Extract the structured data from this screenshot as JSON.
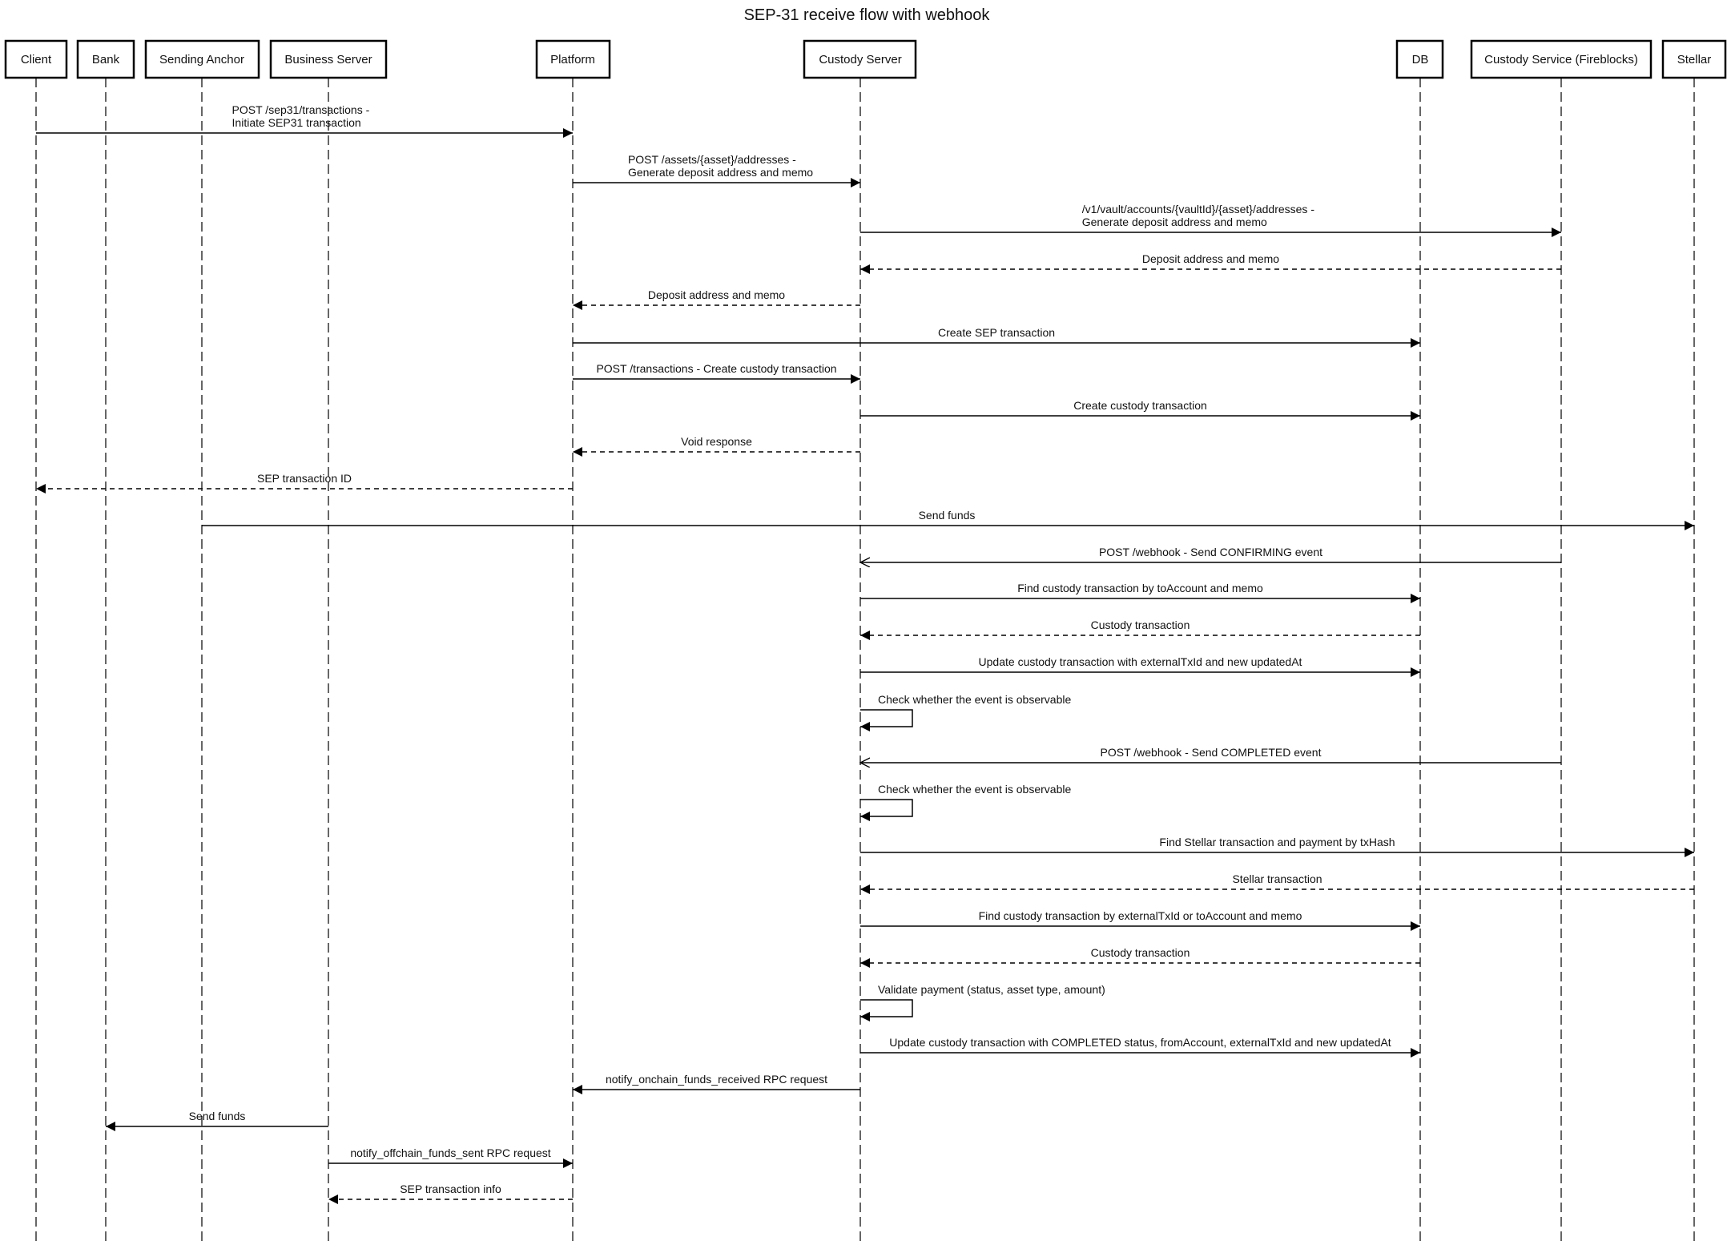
{
  "title": "SEP-31 receive flow with webhook",
  "participants": [
    {
      "id": "client",
      "label": "Client"
    },
    {
      "id": "bank",
      "label": "Bank"
    },
    {
      "id": "sending_anchor",
      "label": "Sending Anchor"
    },
    {
      "id": "business_server",
      "label": "Business Server"
    },
    {
      "id": "platform",
      "label": "Platform"
    },
    {
      "id": "custody_server",
      "label": "Custody Server"
    },
    {
      "id": "db",
      "label": "DB"
    },
    {
      "id": "custody_service",
      "label": "Custody Service (Fireblocks)"
    },
    {
      "id": "stellar",
      "label": "Stellar"
    }
  ],
  "messages": [
    {
      "from": "client",
      "to": "platform",
      "style": "sync",
      "lines": [
        "POST /sep31/transactions -",
        "Initiate SEP31  transaction"
      ]
    },
    {
      "from": "platform",
      "to": "custody_server",
      "style": "sync",
      "lines": [
        "POST /assets/{asset}/addresses -",
        "Generate deposit address and memo"
      ]
    },
    {
      "from": "custody_server",
      "to": "custody_service",
      "style": "sync",
      "lines": [
        "/v1/vault/accounts/{vaultId}/{asset}/addresses -",
        "Generate deposit address and memo"
      ]
    },
    {
      "from": "custody_service",
      "to": "custody_server",
      "style": "reply",
      "lines": [
        "Deposit address and memo"
      ]
    },
    {
      "from": "custody_server",
      "to": "platform",
      "style": "reply",
      "lines": [
        "Deposit address and memo"
      ]
    },
    {
      "from": "platform",
      "to": "db",
      "style": "sync",
      "lines": [
        "Create SEP transaction"
      ]
    },
    {
      "from": "platform",
      "to": "custody_server",
      "style": "sync",
      "lines": [
        "POST /transactions - Create custody transaction"
      ]
    },
    {
      "from": "custody_server",
      "to": "db",
      "style": "sync",
      "lines": [
        "Create custody transaction"
      ]
    },
    {
      "from": "custody_server",
      "to": "platform",
      "style": "reply",
      "lines": [
        "Void response"
      ]
    },
    {
      "from": "platform",
      "to": "client",
      "style": "reply",
      "lines": [
        "SEP transaction ID"
      ]
    },
    {
      "from": "sending_anchor",
      "to": "stellar",
      "style": "sync",
      "lines": [
        "Send funds"
      ]
    },
    {
      "from": "custody_service",
      "to": "custody_server",
      "style": "async",
      "lines": [
        "POST /webhook - Send CONFIRMING event"
      ]
    },
    {
      "from": "custody_server",
      "to": "db",
      "style": "sync",
      "lines": [
        "Find custody transaction by toAccount and memo"
      ]
    },
    {
      "from": "db",
      "to": "custody_server",
      "style": "reply",
      "lines": [
        "Custody transaction"
      ]
    },
    {
      "from": "custody_server",
      "to": "db",
      "style": "sync",
      "lines": [
        "Update custody transaction with externalTxId and new updatedAt"
      ]
    },
    {
      "from": "custody_server",
      "to": "custody_server",
      "style": "self",
      "lines": [
        "Check whether the event is observable"
      ]
    },
    {
      "from": "custody_service",
      "to": "custody_server",
      "style": "async",
      "lines": [
        "POST /webhook - Send COMPLETED event"
      ]
    },
    {
      "from": "custody_server",
      "to": "custody_server",
      "style": "self",
      "lines": [
        "Check whether the event is observable"
      ]
    },
    {
      "from": "custody_server",
      "to": "stellar",
      "style": "sync",
      "lines": [
        "Find Stellar transaction and payment by txHash"
      ]
    },
    {
      "from": "stellar",
      "to": "custody_server",
      "style": "reply",
      "lines": [
        "Stellar transaction"
      ]
    },
    {
      "from": "custody_server",
      "to": "db",
      "style": "sync",
      "lines": [
        "Find custody transaction by externalTxId or toAccount and memo"
      ]
    },
    {
      "from": "db",
      "to": "custody_server",
      "style": "reply",
      "lines": [
        "Custody transaction"
      ]
    },
    {
      "from": "custody_server",
      "to": "custody_server",
      "style": "self",
      "lines": [
        "Validate payment (status, asset type, amount)"
      ]
    },
    {
      "from": "custody_server",
      "to": "db",
      "style": "sync",
      "lines": [
        "Update custody transaction with COMPLETED status, fromAccount, externalTxId and new updatedAt"
      ]
    },
    {
      "from": "custody_server",
      "to": "platform",
      "style": "sync",
      "lines": [
        "notify_onchain_funds_received RPC request"
      ]
    },
    {
      "from": "business_server",
      "to": "bank",
      "style": "sync",
      "lines": [
        "Send funds"
      ]
    },
    {
      "from": "business_server",
      "to": "platform",
      "style": "sync",
      "lines": [
        "notify_offchain_funds_sent RPC request"
      ]
    },
    {
      "from": "platform",
      "to": "business_server",
      "style": "reply",
      "lines": [
        "SEP transaction info"
      ]
    }
  ]
}
